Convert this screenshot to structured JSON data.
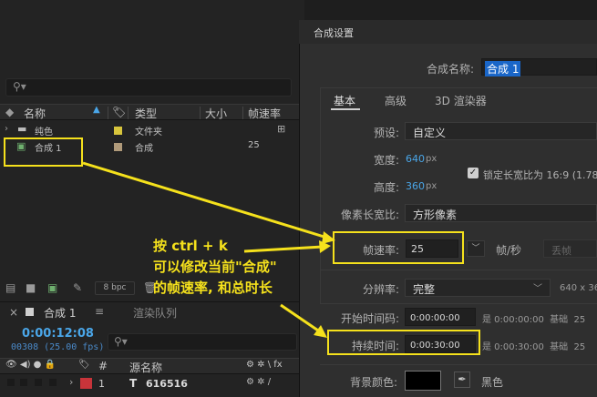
{
  "project": {
    "columns": {
      "name": "名称",
      "type": "类型",
      "size": "大小",
      "framerate": "帧速率"
    },
    "items": [
      {
        "name": "纯色",
        "type": "文件夹",
        "fps": "",
        "swatch": "#d8c53c"
      },
      {
        "name": "合成 1",
        "type": "合成",
        "fps": "25",
        "swatch": "#b09a7a"
      }
    ],
    "footer": {
      "bpc": "8 bpc"
    }
  },
  "timeline": {
    "tab_comp": "合成 1",
    "tab_render": "渲染队列",
    "timecode": "0:00:12:08",
    "framecount": "00308 (25.00 fps)",
    "header_source": "源名称",
    "row": {
      "index": "1",
      "layer_type": "T",
      "name": "616516",
      "label_color": "#c8343a"
    }
  },
  "dialog": {
    "title": "合成设置",
    "name_label": "合成名称:",
    "name_value": "合成 1",
    "tabs": [
      "基本",
      "高级",
      "3D 渲染器"
    ],
    "preset_label": "预设:",
    "preset_value": "自定义",
    "width_label": "宽度:",
    "width_value": "640",
    "width_unit": "px",
    "height_label": "高度:",
    "height_value": "360",
    "height_unit": "px",
    "lock_label": "锁定长宽比为 16:9 (1.78",
    "pixel_aspect_label": "像素长宽比:",
    "pixel_aspect_value": "方形像素",
    "framerate_label": "帧速率:",
    "framerate_value": "25",
    "framerate_unit": "帧/秒",
    "drop_frame": "丢帧",
    "resolution_label": "分辨率:",
    "resolution_value": "完整",
    "resolution_note": "640 x 36",
    "start_tc_label": "开始时间码:",
    "start_tc_value": "0:00:00:00",
    "start_tc_note": "是 0:00:00:00  基础  25",
    "duration_label": "持续时间:",
    "duration_value": "0:00:30:00",
    "duration_note": "是 0:00:30:00  基础  25",
    "bg_label": "背景颜色:",
    "bg_color_name": "黑色",
    "bg_color": "#000000"
  },
  "annotation": {
    "line1": "按 ctrl + k",
    "line2": "可以修改当前\"合成\"",
    "line3": "的帧速率, 和总时长",
    "color": "#f5e11c"
  }
}
